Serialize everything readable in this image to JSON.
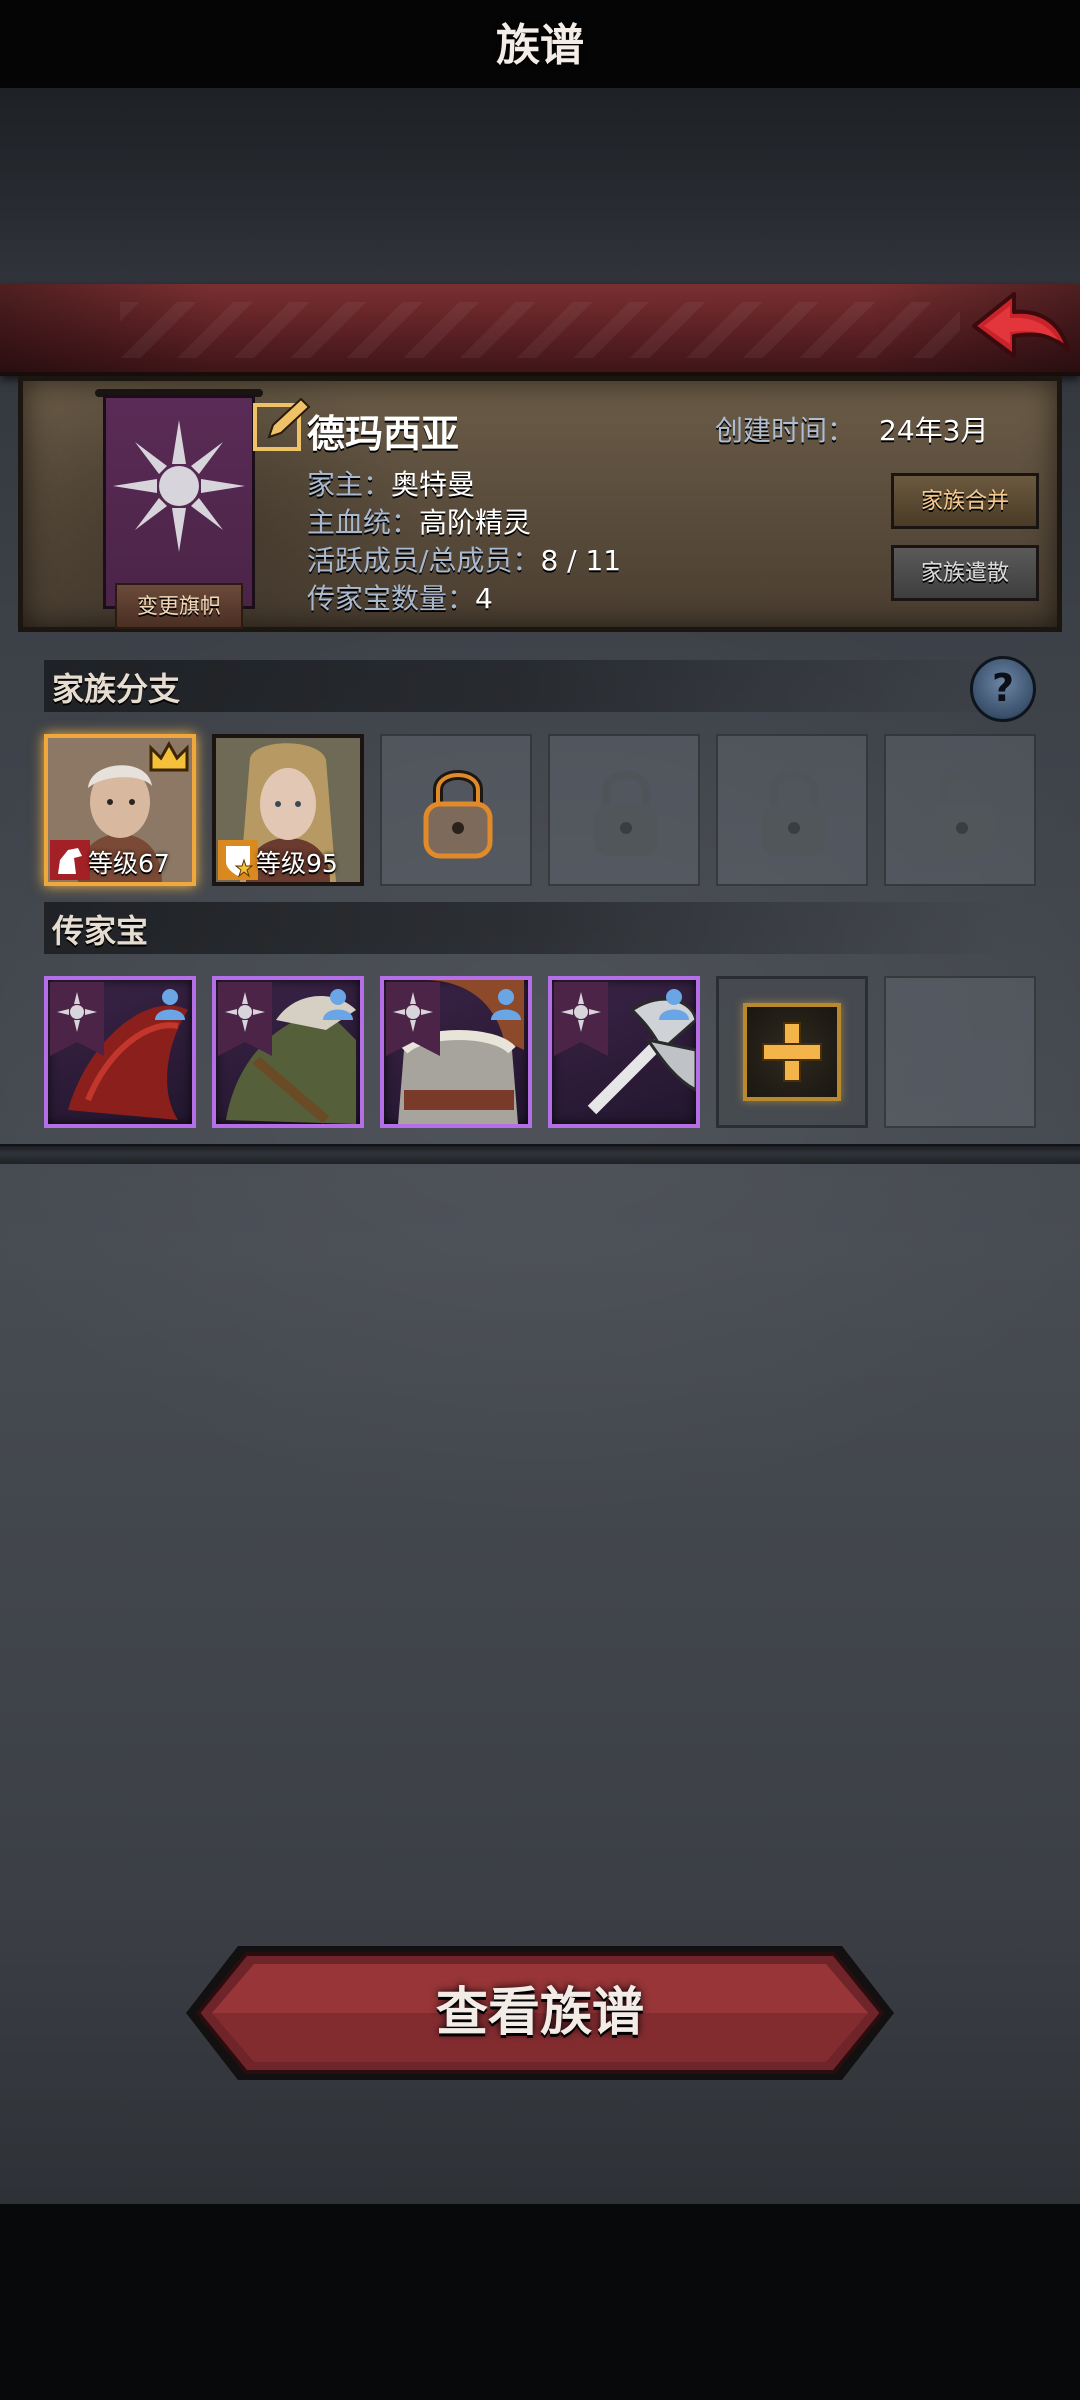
{
  "header": {
    "title": "族谱"
  },
  "family": {
    "name": "德玛西亚",
    "created_label": "创建时间：",
    "created_value": "24年3月",
    "head_label": "家主：",
    "head_value": "奥特曼",
    "bloodline_label": "主血统：",
    "bloodline_value": "高阶精灵",
    "members_label": "活跃成员/总成员：",
    "members_value": "8 / 11",
    "heirloom_label": "传家宝数量：",
    "heirloom_value": "4",
    "change_banner_label": "变更旗帜",
    "merge_label": "家族合并",
    "disband_label": "家族遣散",
    "banner_color": "#4b2448"
  },
  "branches": {
    "title": "家族分支",
    "members": [
      {
        "level_text": "等级67",
        "is_leader": true,
        "icon": "horse-icon"
      },
      {
        "level_text": "等级95",
        "is_leader": false,
        "icon": "star-shield-icon"
      }
    ],
    "locked_slots": 4
  },
  "heirlooms": {
    "title": "传家宝",
    "items": [
      {
        "name": "red-wing-item"
      },
      {
        "name": "green-cloak-item"
      },
      {
        "name": "chainmail-armor-item"
      },
      {
        "name": "silver-axe-item"
      }
    ],
    "rarity_color": "#b46ee6"
  },
  "footer": {
    "view_button_label": "查看族谱"
  },
  "colors": {
    "accent_red": "#6a2428",
    "gold": "#f3b44a",
    "purple": "#b46ee6"
  }
}
